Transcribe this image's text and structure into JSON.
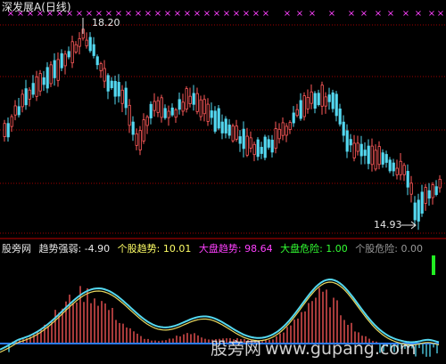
{
  "title": "深发展A(日线)",
  "high_marker": "18.20",
  "low_marker": "14.93",
  "indicator": {
    "name": "股旁网",
    "label1": "趋势强弱: -4.90",
    "label2": "个股趋势: 10.01",
    "label3": "大盘趋势: 98.64",
    "label4": "大盘危险: 1.00",
    "label5": "个股危险: 0.00"
  },
  "watermark": {
    "cn": "股旁网",
    "url": "www.gupang.com"
  },
  "colors": {
    "up": "#ff5a5a",
    "down": "#54d8f0",
    "grid": "#b00000",
    "cross": "#ff40ff",
    "yellow": "#ffff66",
    "magenta": "#ff40ff",
    "green": "#33ff33"
  },
  "chart_data": {
    "type": "candlestick",
    "high": 18.2,
    "low": 14.93
  }
}
